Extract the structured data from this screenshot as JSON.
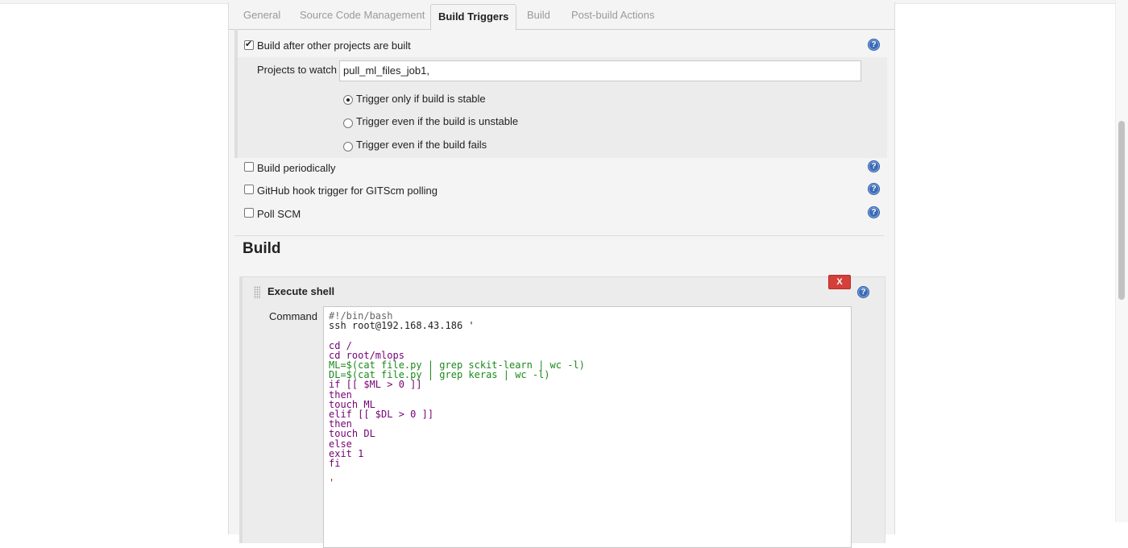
{
  "tabs": [
    {
      "label": "General",
      "active": false
    },
    {
      "label": "Source Code Management",
      "active": false
    },
    {
      "label": "Build Triggers",
      "active": true
    },
    {
      "label": "Build",
      "active": false
    },
    {
      "label": "Post-build Actions",
      "active": false
    }
  ],
  "triggers": {
    "build_after": {
      "label": "Build after other projects are built",
      "checked": true
    },
    "projects_to_watch": {
      "label": "Projects to watch",
      "value": "pull_ml_files_job1,"
    },
    "radios": [
      {
        "label": "Trigger only if build is stable",
        "checked": true
      },
      {
        "label": "Trigger even if the build is unstable",
        "checked": false
      },
      {
        "label": "Trigger even if the build fails",
        "checked": false
      }
    ],
    "build_periodically": {
      "label": "Build periodically",
      "checked": false
    },
    "github_hook": {
      "label": "GitHub hook trigger for GITScm polling",
      "checked": false
    },
    "poll_scm": {
      "label": "Poll SCM",
      "checked": false
    }
  },
  "build": {
    "heading": "Build",
    "step_title": "Execute shell",
    "delete_label": "X",
    "command_label": "Command",
    "help_glyph": "?",
    "code_lines": [
      "#!/bin/bash",
      "ssh root@192.168.43.186 '",
      "",
      "cd /",
      "cd root/mlops",
      "ML=$(cat file.py | grep sckit-learn | wc -l)",
      "DL=$(cat file.py | grep keras | wc -l)",
      "if [[ $ML > 0 ]]",
      "then",
      "touch ML",
      "elif [[ $DL > 0 ]]",
      "then",
      "touch DL",
      "else",
      "exit 1",
      "fi",
      "",
      "'"
    ]
  },
  "colors": {
    "help_icon": "#3d6cb6",
    "delete_button": "#d43f3a",
    "panel_bg": "#f4f4f4"
  }
}
